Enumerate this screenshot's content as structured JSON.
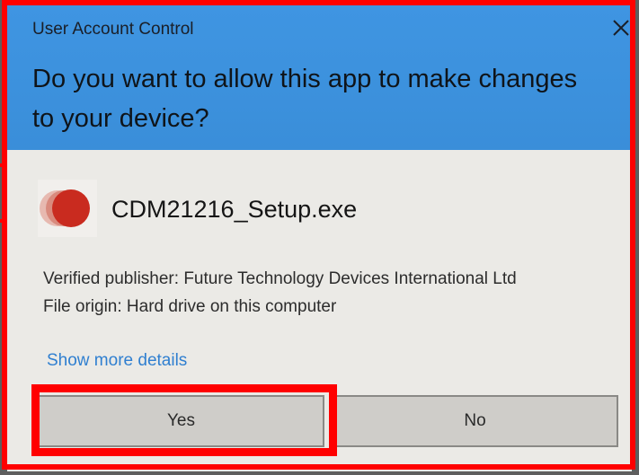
{
  "dialog": {
    "title": "User Account Control",
    "question": "Do you want to allow this app to make changes to your device?",
    "app_name": "CDM21216_Setup.exe",
    "publisher": "Verified publisher: Future Technology Devices International Ltd",
    "origin": "File origin: Hard drive on this computer",
    "more_details": "Show more details",
    "close_icon": "close-icon"
  },
  "buttons": {
    "yes": "Yes",
    "no": "No"
  },
  "colors": {
    "header": "#3f95e2",
    "annotation": "#ff0000",
    "link": "#2f7fd0"
  }
}
